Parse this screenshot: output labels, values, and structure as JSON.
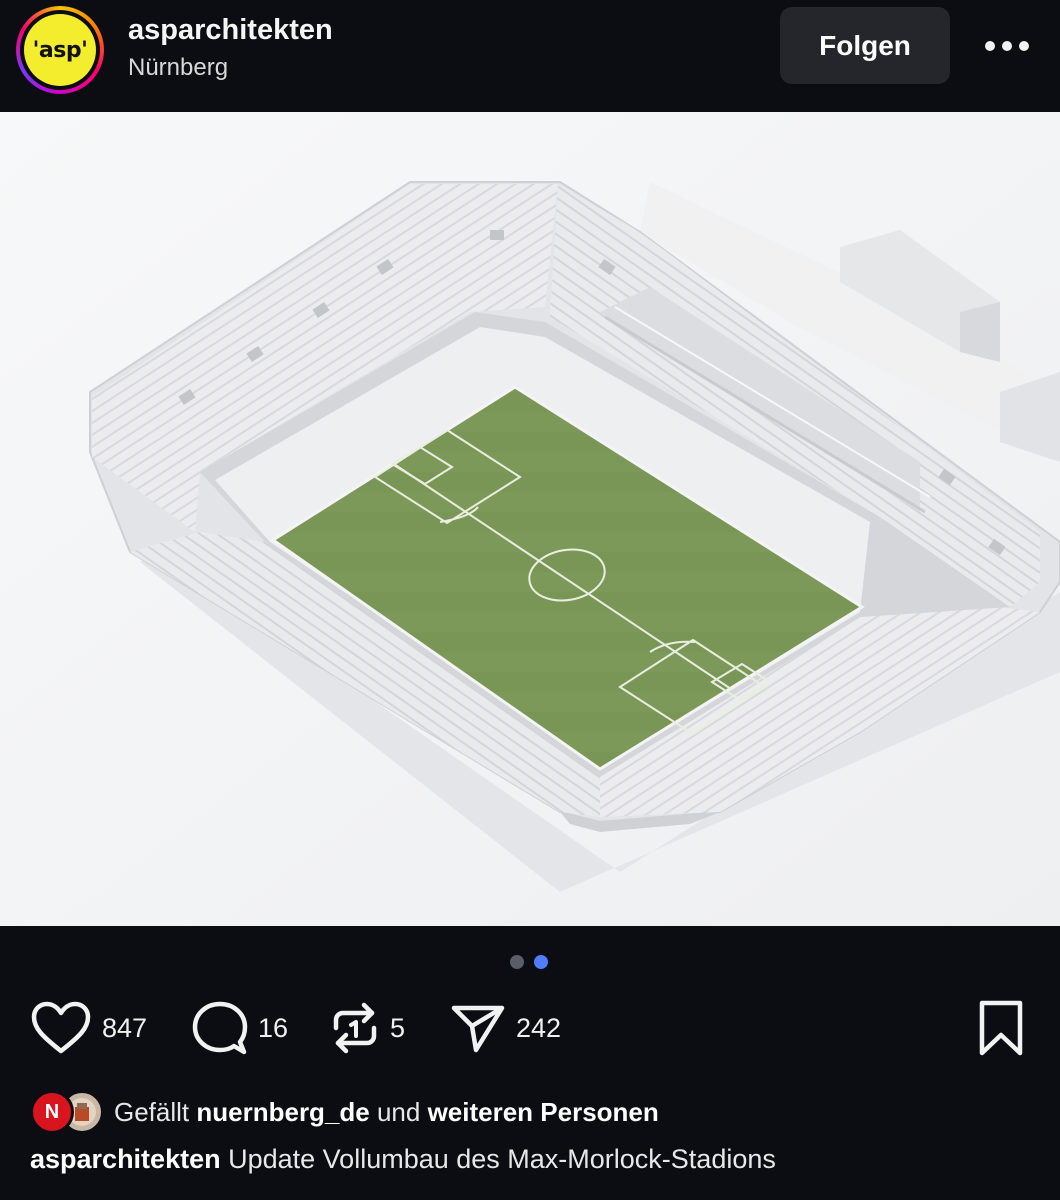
{
  "header": {
    "avatar_text": "'asp'",
    "username": "asparchitekten",
    "location": "Nürnberg",
    "follow_label": "Folgen",
    "more_icon": "more-dots-icon"
  },
  "post": {
    "image_icon": "stadium-render-image",
    "carousel": {
      "count": 2,
      "active_index": 1
    }
  },
  "actions": {
    "like": {
      "icon": "heart-icon",
      "count": "847"
    },
    "comment": {
      "icon": "comment-icon",
      "count": "16"
    },
    "repost": {
      "icon": "repost-icon",
      "count": "5"
    },
    "share": {
      "icon": "send-icon",
      "count": "242"
    },
    "save": {
      "icon": "bookmark-icon"
    }
  },
  "likes": {
    "prefix": "Gefällt ",
    "user": "nuernberg_de",
    "middle": " und ",
    "others": "weiteren Personen",
    "avatar1_text": "N"
  },
  "caption": {
    "username": "asparchitekten",
    "text": " Update Vollumbau des Max-Morlock-Stadions"
  },
  "colors": {
    "background": "#0b0d12",
    "dot_active": "#4f7dff",
    "dot_inactive": "#5a5e66",
    "avatar_yellow": "#f3ed2e",
    "pitch_green": "#7e9a5a"
  }
}
